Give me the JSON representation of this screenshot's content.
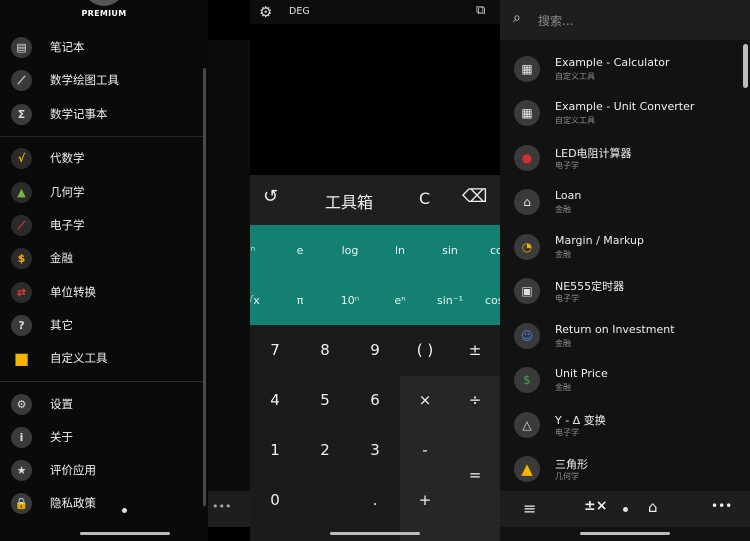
{
  "drawer": {
    "premium": "PREMIUM",
    "items": [
      {
        "label": "笔记本",
        "icon": "document-icon"
      },
      {
        "label": "数学绘图工具",
        "icon": "chart-line-icon"
      },
      {
        "label": "数学记事本",
        "icon": "sigma-icon"
      },
      {
        "label": "代数学",
        "icon": "sqrt-icon"
      },
      {
        "label": "几何学",
        "icon": "geometry-icon"
      },
      {
        "label": "电子学",
        "icon": "resistor-icon"
      },
      {
        "label": "金融",
        "icon": "money-bag-icon"
      },
      {
        "label": "单位转换",
        "icon": "swap-icon"
      },
      {
        "label": "其它",
        "icon": "question-icon"
      },
      {
        "label": "自定义工具",
        "icon": "folder-icon"
      },
      {
        "label": "设置",
        "icon": "gear-icon"
      },
      {
        "label": "关于",
        "icon": "info-icon"
      },
      {
        "label": "评价应用",
        "icon": "star-icon"
      },
      {
        "label": "隐私政策",
        "icon": "lock-icon"
      }
    ]
  },
  "calculator": {
    "angle_mode": "DEG",
    "toolbar": {
      "tools_label": "工具箱",
      "clear_label": "C",
      "history_glyph": "↺",
      "backspace_glyph": "⌫"
    },
    "sci_row1": [
      "ⁿ",
      "e",
      "log",
      "ln",
      "sin",
      "co"
    ],
    "sci_row2": [
      "√x",
      "π",
      "10ⁿ",
      "eⁿ",
      "sin⁻¹",
      "cos"
    ],
    "keys": {
      "row1": [
        "7",
        "8",
        "9",
        "( )",
        "±"
      ],
      "row2": [
        "4",
        "5",
        "6",
        "×",
        "÷"
      ],
      "row3": [
        "1",
        "2",
        "3",
        "-"
      ],
      "row4": [
        "0",
        ".",
        "+"
      ],
      "equals": "="
    },
    "side_dots": "•••"
  },
  "tools_list": {
    "search_placeholder": "搜索...",
    "items": [
      {
        "title": "Example - Calculator",
        "subtitle": "自定义工具",
        "icon": "calculator-icon",
        "color": "#3a3a3a"
      },
      {
        "title": "Example - Unit Converter",
        "subtitle": "自定义工具",
        "icon": "calculator-icon",
        "color": "#3a3a3a"
      },
      {
        "title": "LED电阻计算器",
        "subtitle": "电子学",
        "icon": "led-icon",
        "color": "#d32f2f"
      },
      {
        "title": "Loan",
        "subtitle": "金融",
        "icon": "bank-icon",
        "color": "#e0e0e0"
      },
      {
        "title": "Margin / Markup",
        "subtitle": "金融",
        "icon": "pie-chart-icon",
        "color": "#f4b400"
      },
      {
        "title": "NE555定时器",
        "subtitle": "电子学",
        "icon": "chip-icon",
        "color": "#e0e0e0"
      },
      {
        "title": "Return on Investment",
        "subtitle": "金融",
        "icon": "investor-icon",
        "color": "#4285f4"
      },
      {
        "title": "Unit Price",
        "subtitle": "金融",
        "icon": "price-tag-icon",
        "color": "#2e7d32"
      },
      {
        "title": "Y - Δ 变换",
        "subtitle": "电子学",
        "icon": "triangle-outline-icon",
        "color": "#e0e0e0"
      },
      {
        "title": "三角形",
        "subtitle": "几何学",
        "icon": "triangle-icon",
        "color": "#f4b400"
      }
    ]
  },
  "colors": {
    "teal": "#138072",
    "panel": "#1b1b1b"
  }
}
